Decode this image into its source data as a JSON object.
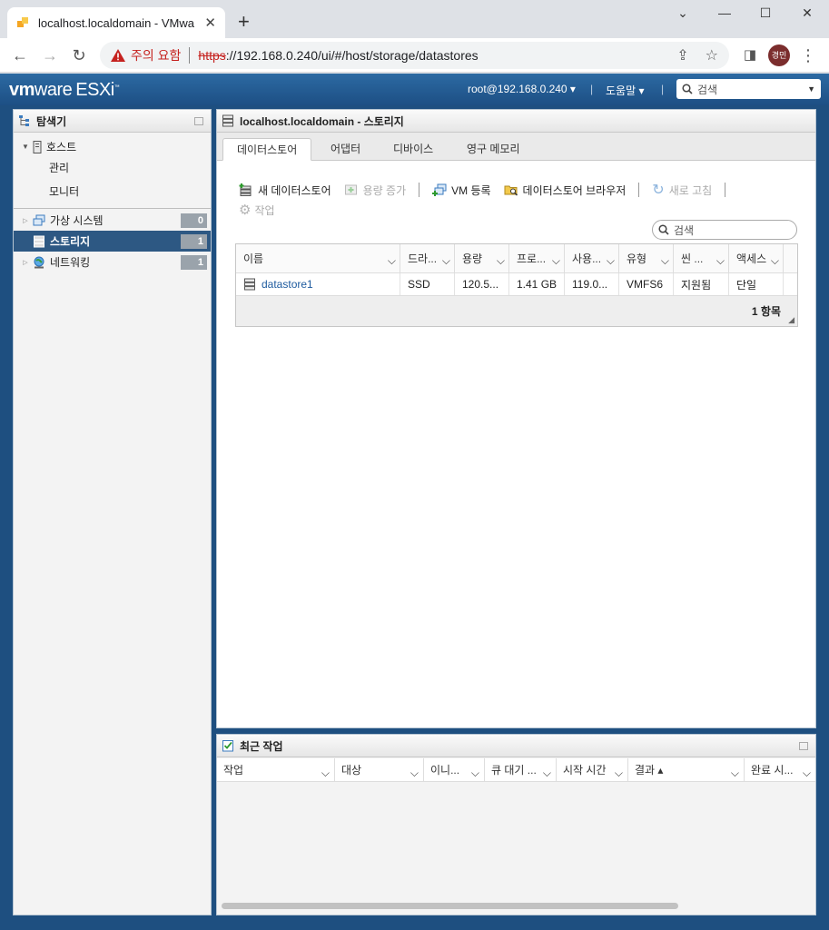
{
  "browser": {
    "tab_title": "localhost.localdomain - VMware",
    "warning_label": "주의 요함",
    "url_scheme": "https",
    "url_rest": "://192.168.0.240/ui/#/host/storage/datastores",
    "profile_initials": "경민"
  },
  "esxi_header": {
    "logo_vm": "vm",
    "logo_ware": "ware",
    "logo_product": "ESXi",
    "user": "root@192.168.0.240 ▾",
    "help": "도움말 ▾",
    "search_placeholder": "검색"
  },
  "navigator": {
    "title": "탐색기",
    "host_label": "호스트",
    "host_children": [
      "관리",
      "모니터"
    ],
    "items": [
      {
        "label": "가상 시스템",
        "count": "0"
      },
      {
        "label": "스토리지",
        "count": "1"
      },
      {
        "label": "네트워킹",
        "count": "1"
      }
    ]
  },
  "content": {
    "title": "localhost.localdomain - 스토리지",
    "tabs": [
      "데이터스토어",
      "어댑터",
      "디바이스",
      "영구 메모리"
    ],
    "actions": {
      "new_datastore": "새 데이터스토어",
      "increase_capacity": "용량 증가",
      "register_vm": "VM 등록",
      "datastore_browser": "데이터스토어 브라우저",
      "refresh": "새로 고침",
      "tasks": "작업"
    },
    "search_placeholder": "검색",
    "columns": [
      "이름",
      "드라...",
      "용량",
      "프로...",
      "사용...",
      "유형",
      "씬 ...",
      "액세스"
    ],
    "rows": [
      [
        "datastore1",
        "SSD",
        "120.5...",
        "1.41 GB",
        "119.0...",
        "VMFS6",
        "지원됨",
        "단일"
      ]
    ],
    "footer": "1 항목"
  },
  "recent_tasks": {
    "title": "최근 작업",
    "columns": [
      "작업",
      "대상",
      "이니...",
      "큐 대기 ...",
      "시작 시간",
      "결과 ▴",
      "완료 시..."
    ]
  },
  "colors": {
    "esxi_header": "#1d4f84",
    "selected_nav": "#2d5883",
    "warning": "#c5221f",
    "link": "#1d5a9e"
  }
}
